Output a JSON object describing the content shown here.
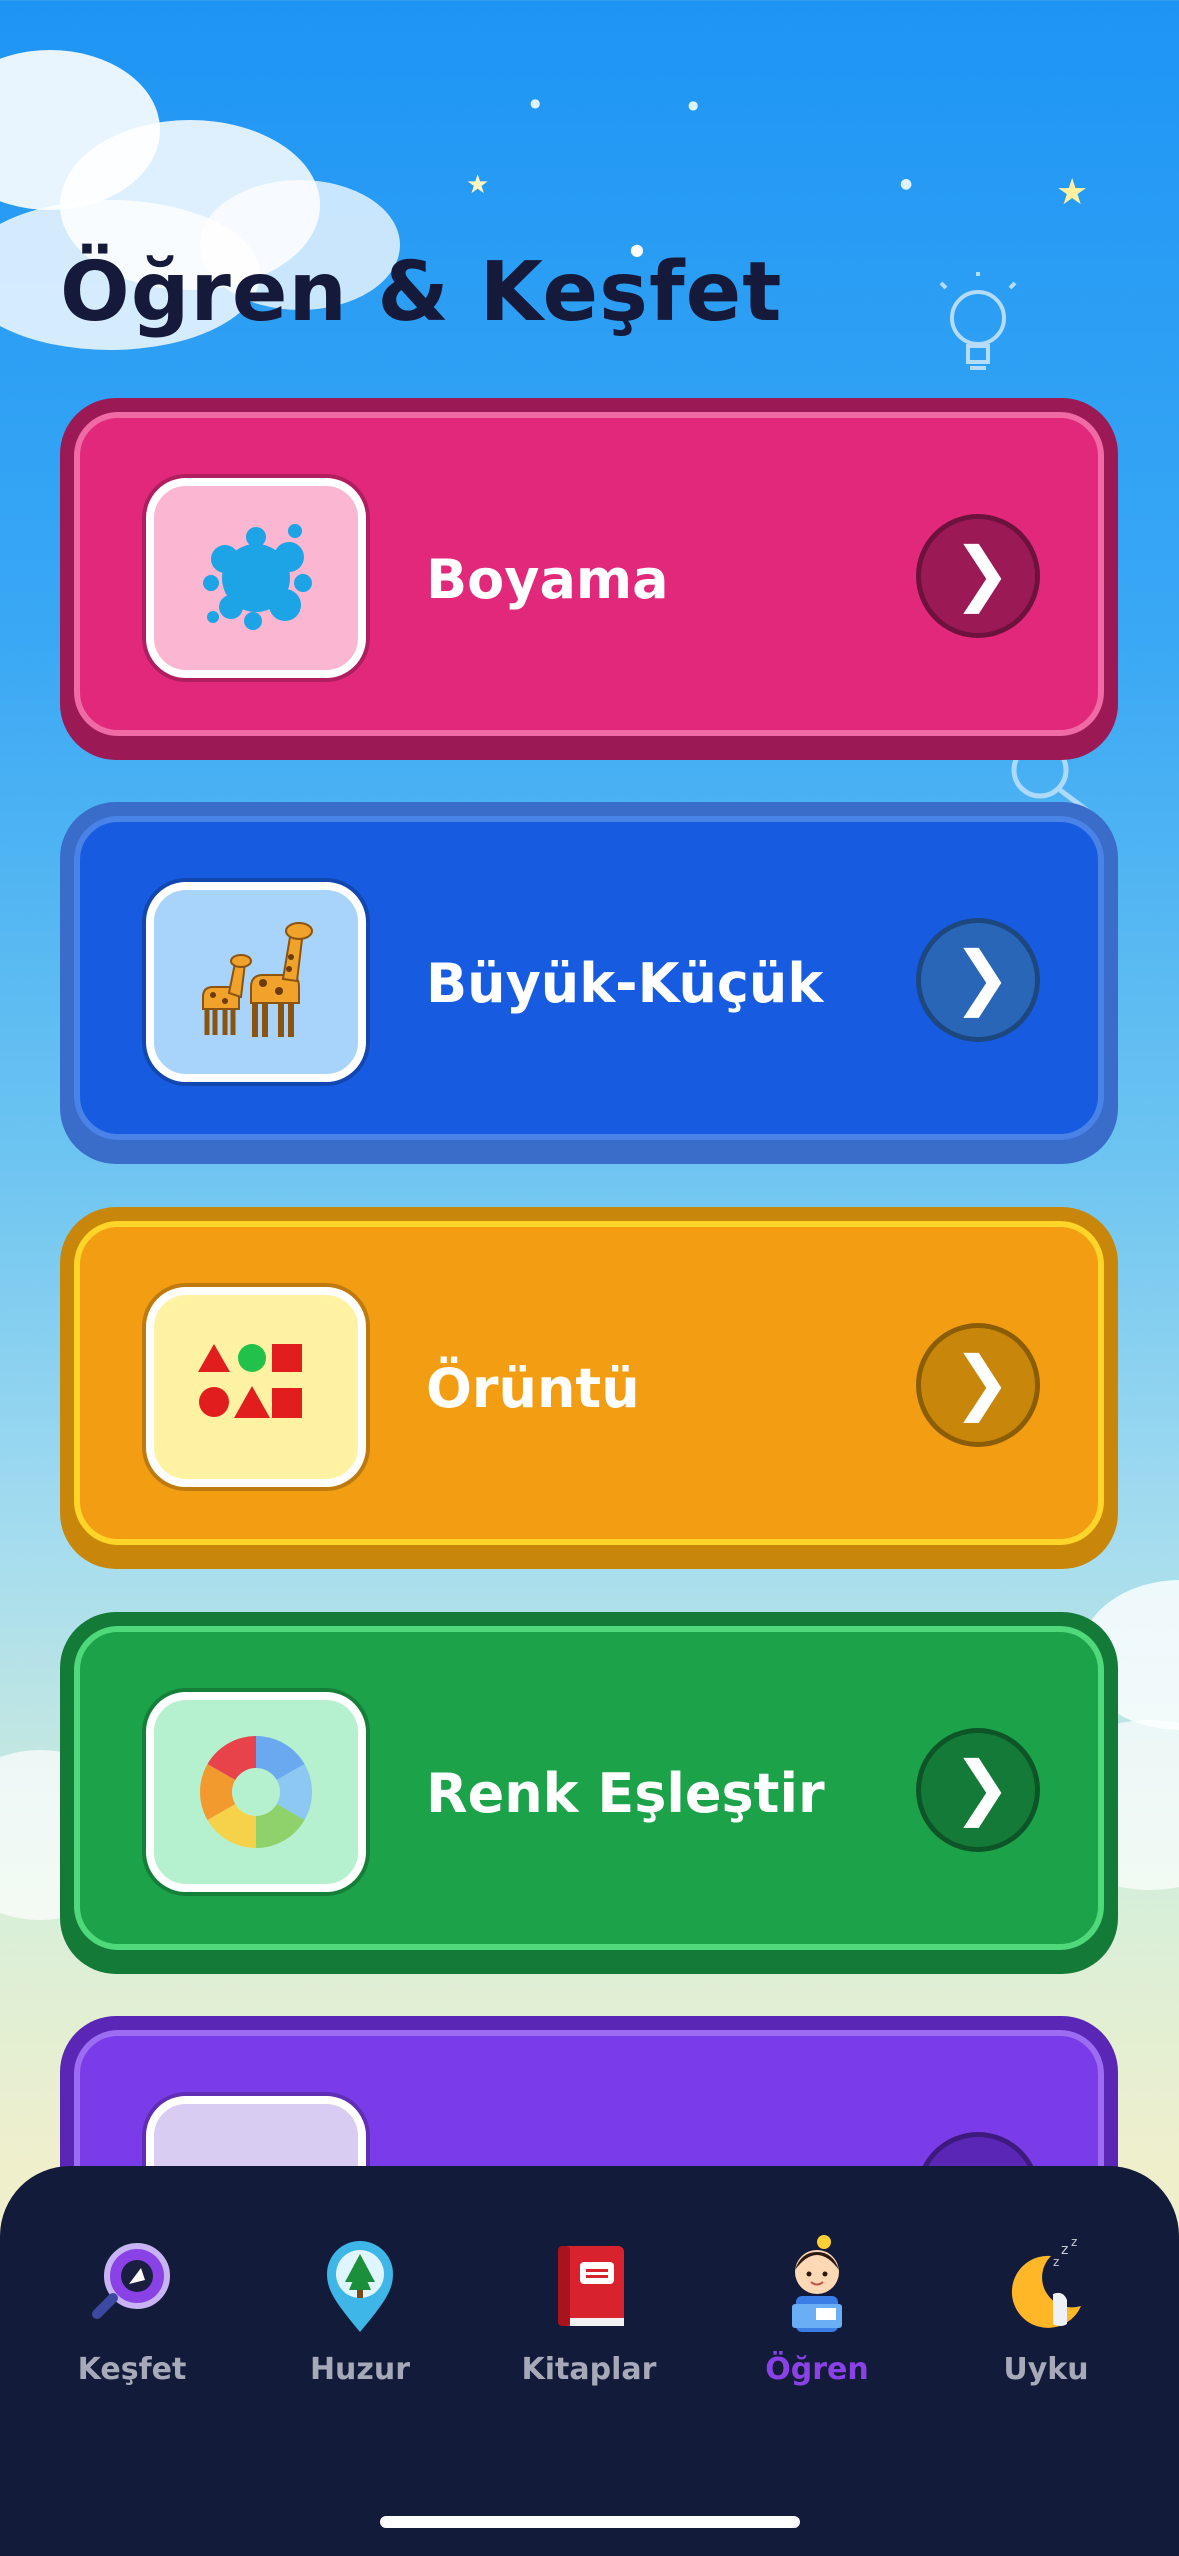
{
  "page": {
    "title": "Öğren & Keşfet"
  },
  "cards": [
    {
      "label": "Boyama",
      "icon": "paint-splash-icon",
      "color": "#e1287a",
      "border": "#f06aa5",
      "thumb_bg": "#fbb7d2",
      "btn": "#9b1a56"
    },
    {
      "label": "Büyük-Küçük",
      "icon": "giraffes-icon",
      "color": "#175ce0",
      "border": "#4a83e8",
      "thumb_bg": "#a8d4fb",
      "btn": "#2a66b7"
    },
    {
      "label": "Örüntü",
      "icon": "shapes-icon",
      "color": "#f29d12",
      "border": "#ffd52a",
      "thumb_bg": "#fff3a3",
      "btn": "#c8870a"
    },
    {
      "label": "Renk Eşleştir",
      "icon": "color-wheel-icon",
      "color": "#1ca34a",
      "border": "#4fd97b",
      "thumb_bg": "#b6f1cf",
      "btn": "#147a38"
    },
    {
      "label": "",
      "icon": "partial-card-icon",
      "color": "#7a3ce8",
      "border": "#9c6cf3",
      "thumb_bg": "#d9ccf3",
      "btn": "#5a26b6"
    }
  ],
  "tabbar": {
    "items": [
      {
        "label": "Keşfet",
        "icon": "discover-icon",
        "active": false
      },
      {
        "label": "Huzur",
        "icon": "tree-pin-icon",
        "active": false
      },
      {
        "label": "Kitaplar",
        "icon": "book-icon",
        "active": false
      },
      {
        "label": "Öğren",
        "icon": "child-reading-icon",
        "active": true
      },
      {
        "label": "Uyku",
        "icon": "moon-sleep-icon",
        "active": false
      }
    ]
  },
  "colors": {
    "title": "#15193a",
    "tabbar_bg": "#131b3a",
    "active_tab": "#8a42e6",
    "inactive_tab": "#a6a9b8"
  }
}
